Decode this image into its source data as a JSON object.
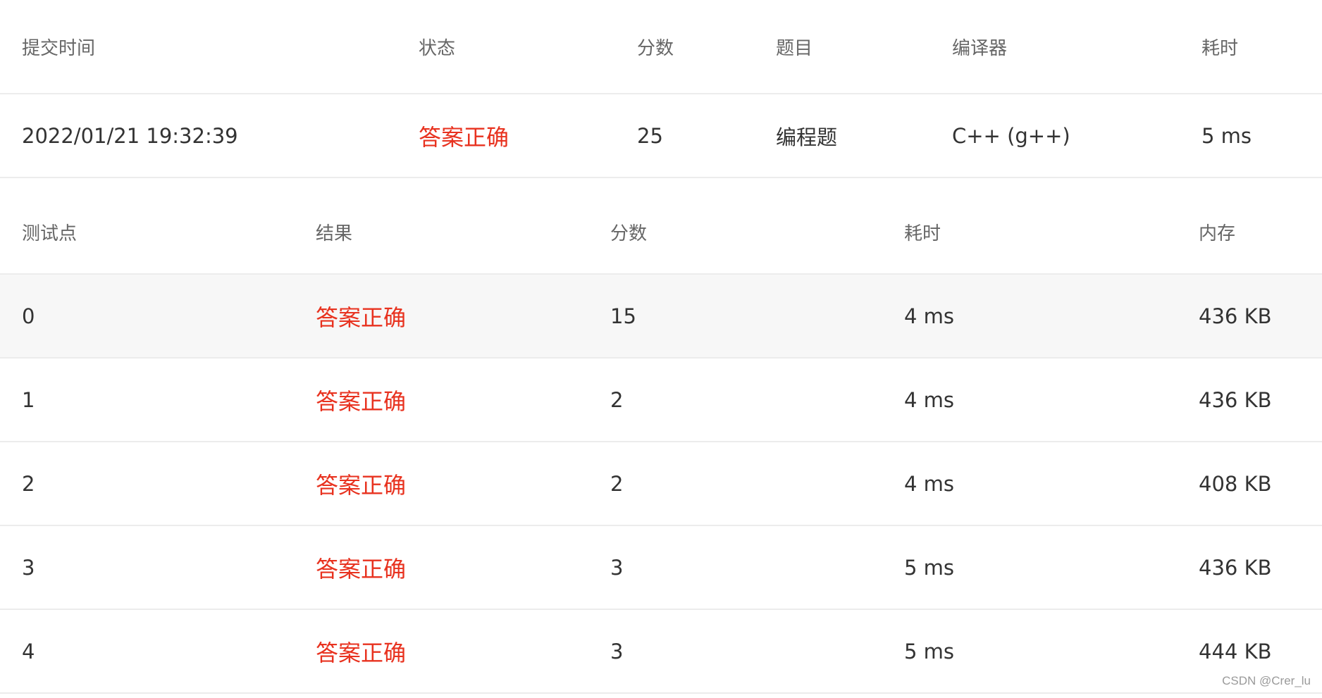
{
  "submission": {
    "headers": {
      "time": "提交时间",
      "status": "状态",
      "score": "分数",
      "problem": "题目",
      "compiler": "编译器",
      "duration": "耗时"
    },
    "row": {
      "time": "2022/01/21 19:32:39",
      "status": "答案正确",
      "score": "25",
      "problem": "编程题",
      "compiler": "C++ (g++)",
      "duration": "5 ms"
    }
  },
  "testcases": {
    "headers": {
      "case": "测试点",
      "result": "结果",
      "score": "分数",
      "duration": "耗时",
      "memory": "内存"
    },
    "rows": [
      {
        "case": "0",
        "result": "答案正确",
        "score": "15",
        "duration": "4 ms",
        "memory": "436 KB"
      },
      {
        "case": "1",
        "result": "答案正确",
        "score": "2",
        "duration": "4 ms",
        "memory": "436 KB"
      },
      {
        "case": "2",
        "result": "答案正确",
        "score": "2",
        "duration": "4 ms",
        "memory": "408 KB"
      },
      {
        "case": "3",
        "result": "答案正确",
        "score": "3",
        "duration": "5 ms",
        "memory": "436 KB"
      },
      {
        "case": "4",
        "result": "答案正确",
        "score": "3",
        "duration": "5 ms",
        "memory": "444 KB"
      }
    ]
  },
  "watermark": "CSDN @Crer_lu",
  "colors": {
    "accepted": "#e8321f",
    "header_text": "#666666",
    "body_text": "#333333",
    "hover_row": "#f7f7f7",
    "divider": "#ececec"
  }
}
